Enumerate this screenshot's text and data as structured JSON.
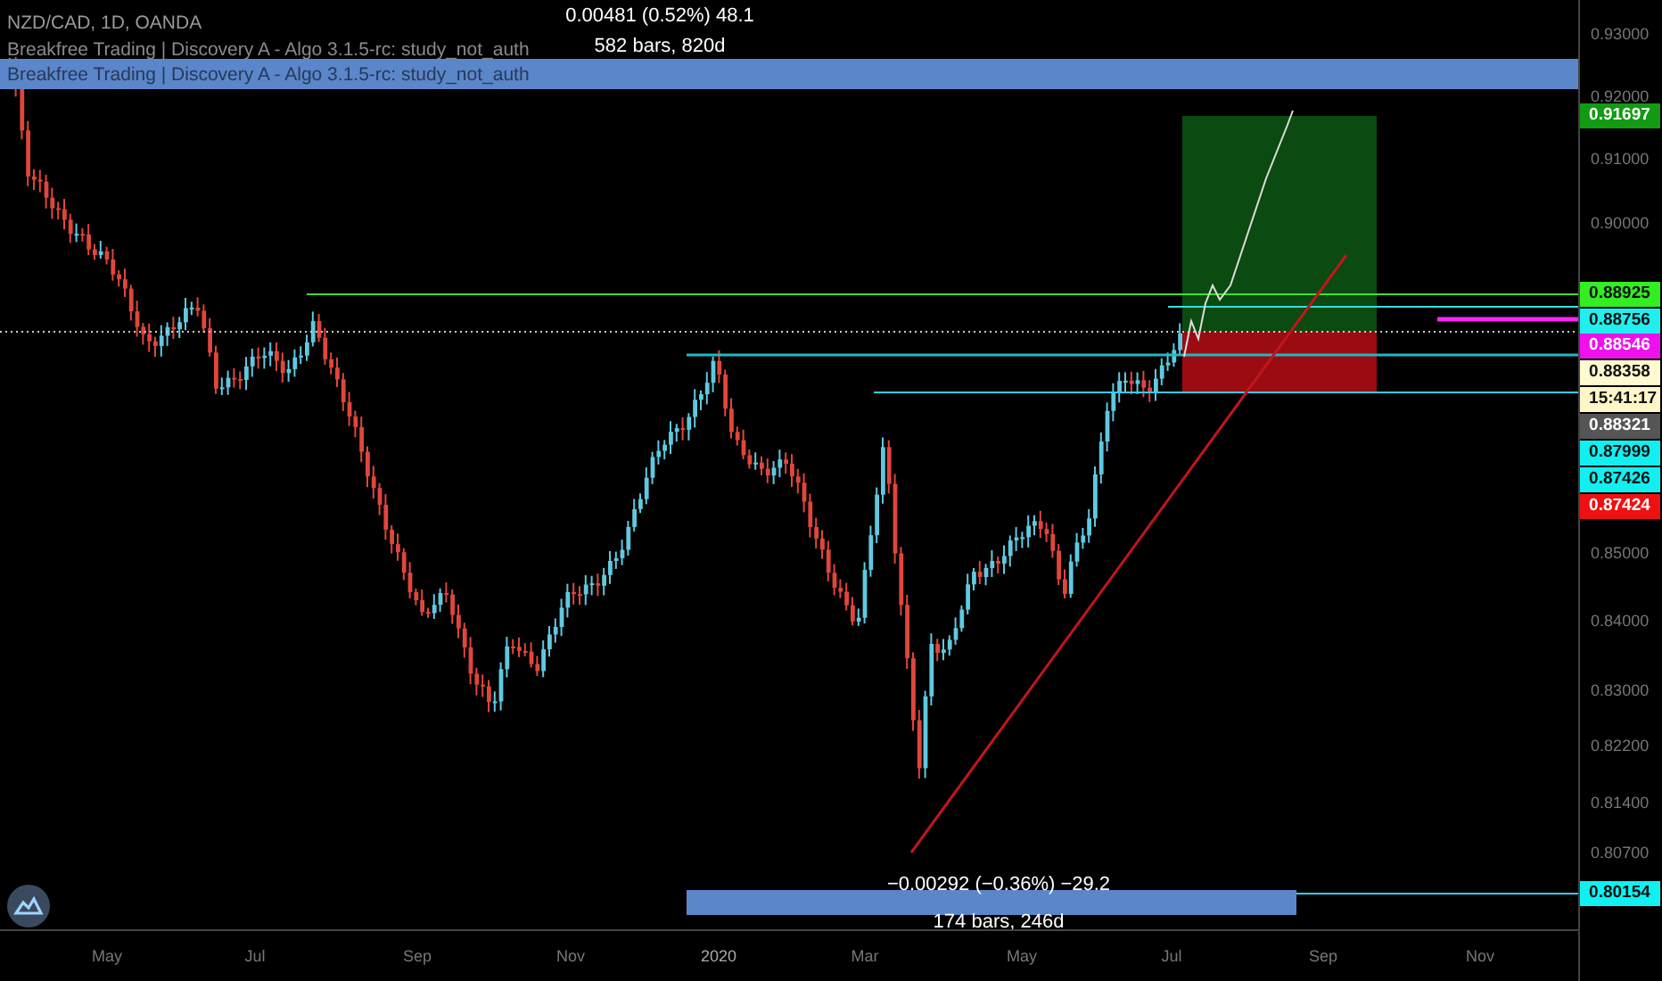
{
  "header": {
    "symbol": "NZD/CAD, 1D, OANDA",
    "indicators": [
      "Breakfree Trading | Discovery A - Algo 3.1.5-rc: study_not_auth",
      "Breakfree Trading | Discovery A - Algo 3.1.5-rc: study_not_auth"
    ]
  },
  "measure_top": {
    "change": "0.00481 (0.52%) 48.1",
    "range": "582 bars, 820d"
  },
  "measure_bottom": {
    "change": "−0.00292 (−0.36%) −29.2",
    "range": "174 bars, 246d"
  },
  "price_axis": {
    "ticks": [
      "0.93000",
      "0.92000",
      "0.91000",
      "0.90000",
      "0.85000",
      "0.84000",
      "0.83000",
      "0.82200",
      "0.81400",
      "0.80700"
    ]
  },
  "price_labels": [
    {
      "text": "0.91697",
      "color": "#139a13"
    },
    {
      "text": "0.88925",
      "color": "#33ee22"
    },
    {
      "text": "0.88756",
      "color": "#22eeee"
    },
    {
      "text": "0.88546",
      "color": "#ee11ee"
    },
    {
      "text": "0.88358",
      "color": "#fffbd0"
    },
    {
      "text": "15:41:17",
      "color": "#fff6c8"
    },
    {
      "text": "0.88321",
      "color": "#555555"
    },
    {
      "text": "0.87999",
      "color": "#11f0f0"
    },
    {
      "text": "0.87426",
      "color": "#11f0f0"
    },
    {
      "text": "0.87424",
      "color": "#ee1111"
    },
    {
      "text": "0.80154",
      "color": "#11f0f0"
    }
  ],
  "time_axis": {
    "ticks": [
      "May",
      "Jul",
      "Sep",
      "Nov",
      "2020",
      "Mar",
      "May",
      "Jul",
      "Sep",
      "Nov"
    ]
  }
}
